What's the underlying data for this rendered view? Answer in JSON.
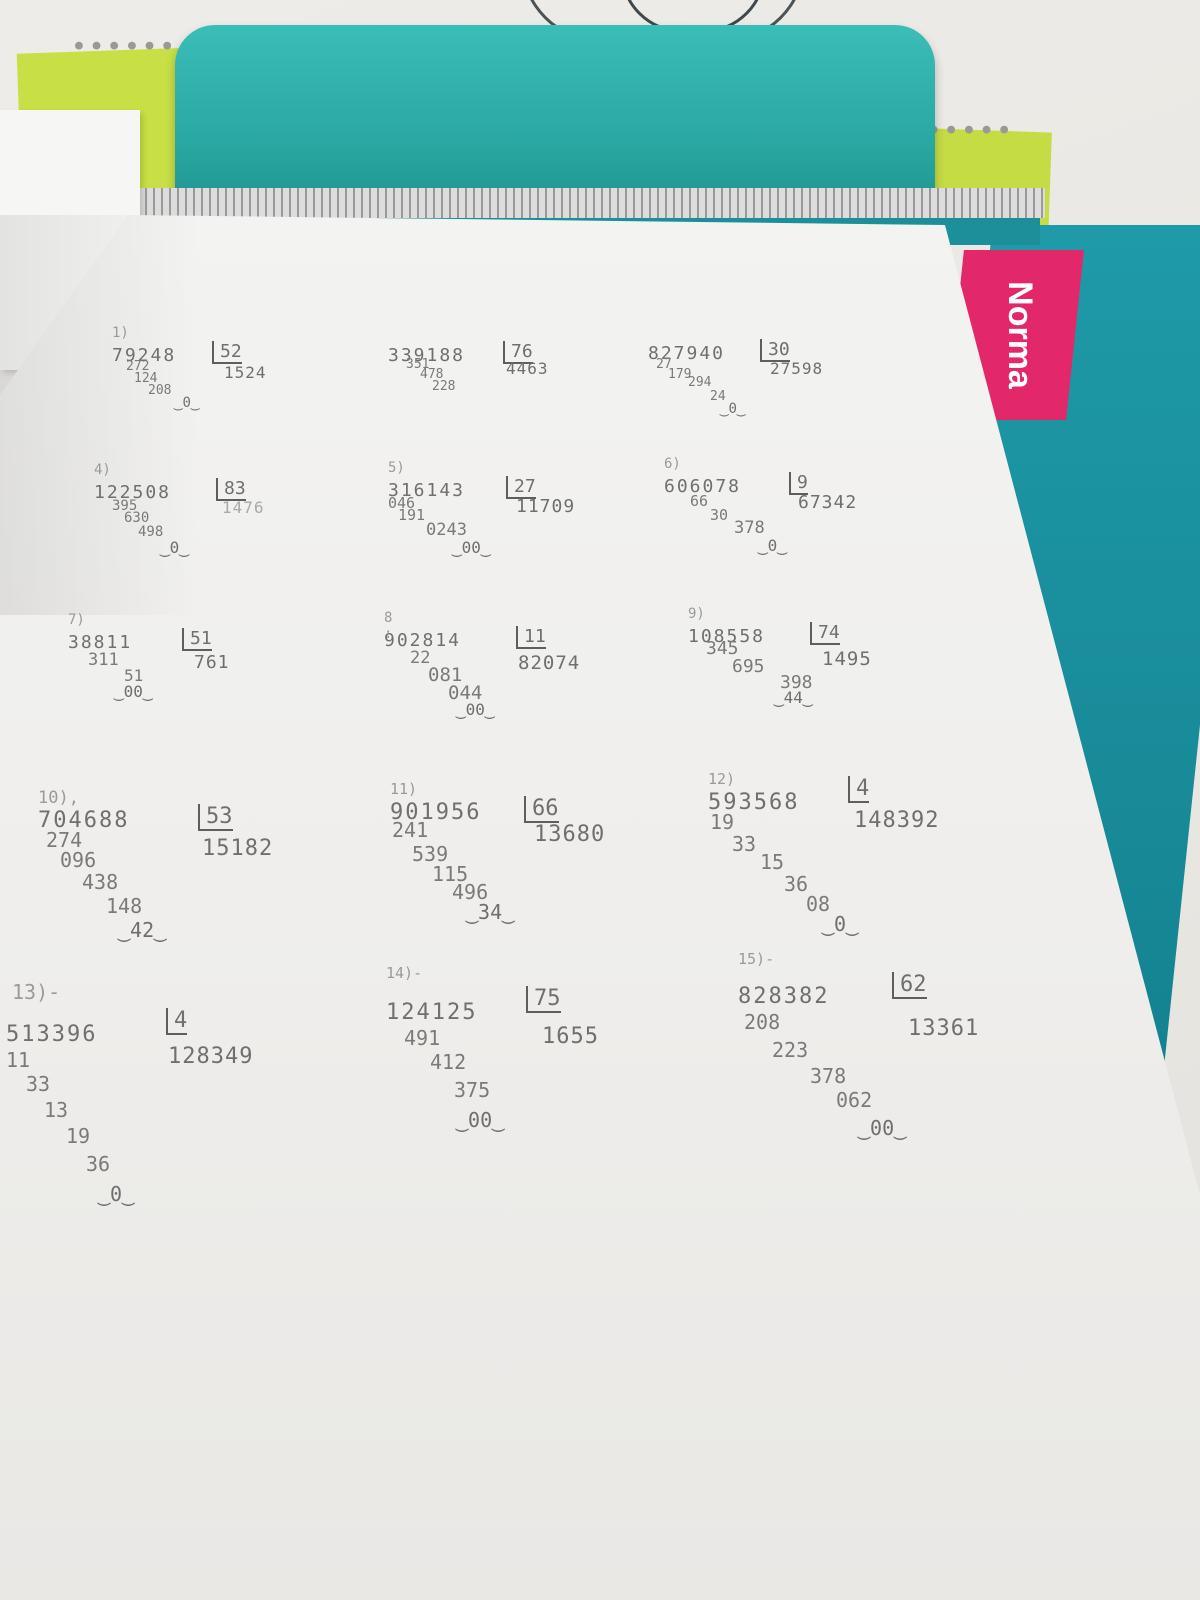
{
  "cover": {
    "brand": "Norma"
  },
  "problems": [
    {
      "label": "1)",
      "dividend": "79248",
      "divisor": "52",
      "quotient": "1524",
      "steps": [
        "272",
        "124",
        "208"
      ],
      "remainder": "0"
    },
    {
      "label": "",
      "dividend": "339188",
      "divisor": "76",
      "quotient": "4463",
      "steps": [
        "351",
        "478",
        "228"
      ],
      "remainder": "0"
    },
    {
      "label": "",
      "dividend": "827940",
      "divisor": "30",
      "quotient": "27598",
      "steps": [
        "27",
        "179",
        "294",
        "24"
      ],
      "remainder": "0"
    },
    {
      "label": "4)",
      "dividend": "122508",
      "divisor": "83",
      "quotient": "1476",
      "steps": [
        "395",
        "630",
        "498"
      ],
      "remainder": "0"
    },
    {
      "label": "5)",
      "dividend": "316143",
      "divisor": "27",
      "quotient": "11709",
      "steps": [
        "046",
        "191",
        "0243"
      ],
      "remainder": "00"
    },
    {
      "label": "6)",
      "dividend": "606078",
      "divisor": "9",
      "quotient": "67342",
      "steps": [
        "66",
        "30",
        "378"
      ],
      "remainder": "0"
    },
    {
      "label": "7)",
      "dividend": "38811",
      "divisor": "51",
      "quotient": "761",
      "steps": [
        "311",
        "51"
      ],
      "remainder": "00"
    },
    {
      "label": "8 :",
      "dividend": "902814",
      "divisor": "11",
      "quotient": "82074",
      "steps": [
        "22",
        "081",
        "044"
      ],
      "remainder": "00"
    },
    {
      "label": "9)",
      "dividend": "108558",
      "divisor": "74",
      "quotient": "1495",
      "steps": [
        "345",
        "695",
        "398"
      ],
      "remainder": "44"
    },
    {
      "label": "10),",
      "dividend": "704688",
      "divisor": "53",
      "quotient": "15182",
      "steps": [
        "274",
        "096",
        "438",
        "148"
      ],
      "remainder": "42"
    },
    {
      "label": "11)",
      "dividend": "901956",
      "divisor": "66",
      "quotient": "13680",
      "steps": [
        "241",
        "539",
        "115",
        "496"
      ],
      "remainder": "34"
    },
    {
      "label": "12)",
      "dividend": "593568",
      "divisor": "4",
      "quotient": "148392",
      "steps": [
        "19",
        "33",
        "15",
        "36",
        "08"
      ],
      "remainder": "0"
    },
    {
      "label": "13)-",
      "dividend": "513396",
      "divisor": "4",
      "quotient": "128349",
      "steps": [
        "11",
        "33",
        "13",
        "19",
        "36"
      ],
      "remainder": "0"
    },
    {
      "label": "14)-",
      "dividend": "124125",
      "divisor": "75",
      "quotient": "1655",
      "steps": [
        "491",
        "412",
        "375"
      ],
      "remainder": "00"
    },
    {
      "label": "15)-",
      "dividend": "828382",
      "divisor": "62",
      "quotient": "13361",
      "steps": [
        "208",
        "223",
        "378",
        "062"
      ],
      "remainder": "00"
    }
  ]
}
